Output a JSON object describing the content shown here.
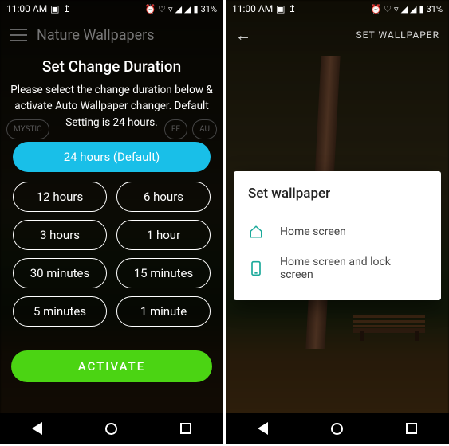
{
  "status": {
    "time": "11:00 AM",
    "battery": "31%"
  },
  "left": {
    "header_title": "Nature Wallpapers",
    "chip1": "MYSTIC",
    "chip2": "FE",
    "chip3": "AU",
    "modal": {
      "title": "Set Change Duration",
      "description": "Please select the change duration below & activate Auto Wallpaper changer. Default Setting is 24 hours.",
      "default_option": "24 hours (Default)",
      "options": [
        "12 hours",
        "6 hours",
        "3 hours",
        "1 hour",
        "30 minutes",
        "15 minutes",
        "5 minutes",
        "1 minute"
      ],
      "activate": "ACTIVATE"
    }
  },
  "right": {
    "action": "SET WALLPAPER",
    "dialog": {
      "title": "Set wallpaper",
      "row1": "Home screen",
      "row2": "Home screen and lock screen"
    }
  },
  "colors": {
    "primary_pill": "#19bfe8",
    "activate": "#4bd413",
    "icon_teal": "#1aa99a"
  }
}
